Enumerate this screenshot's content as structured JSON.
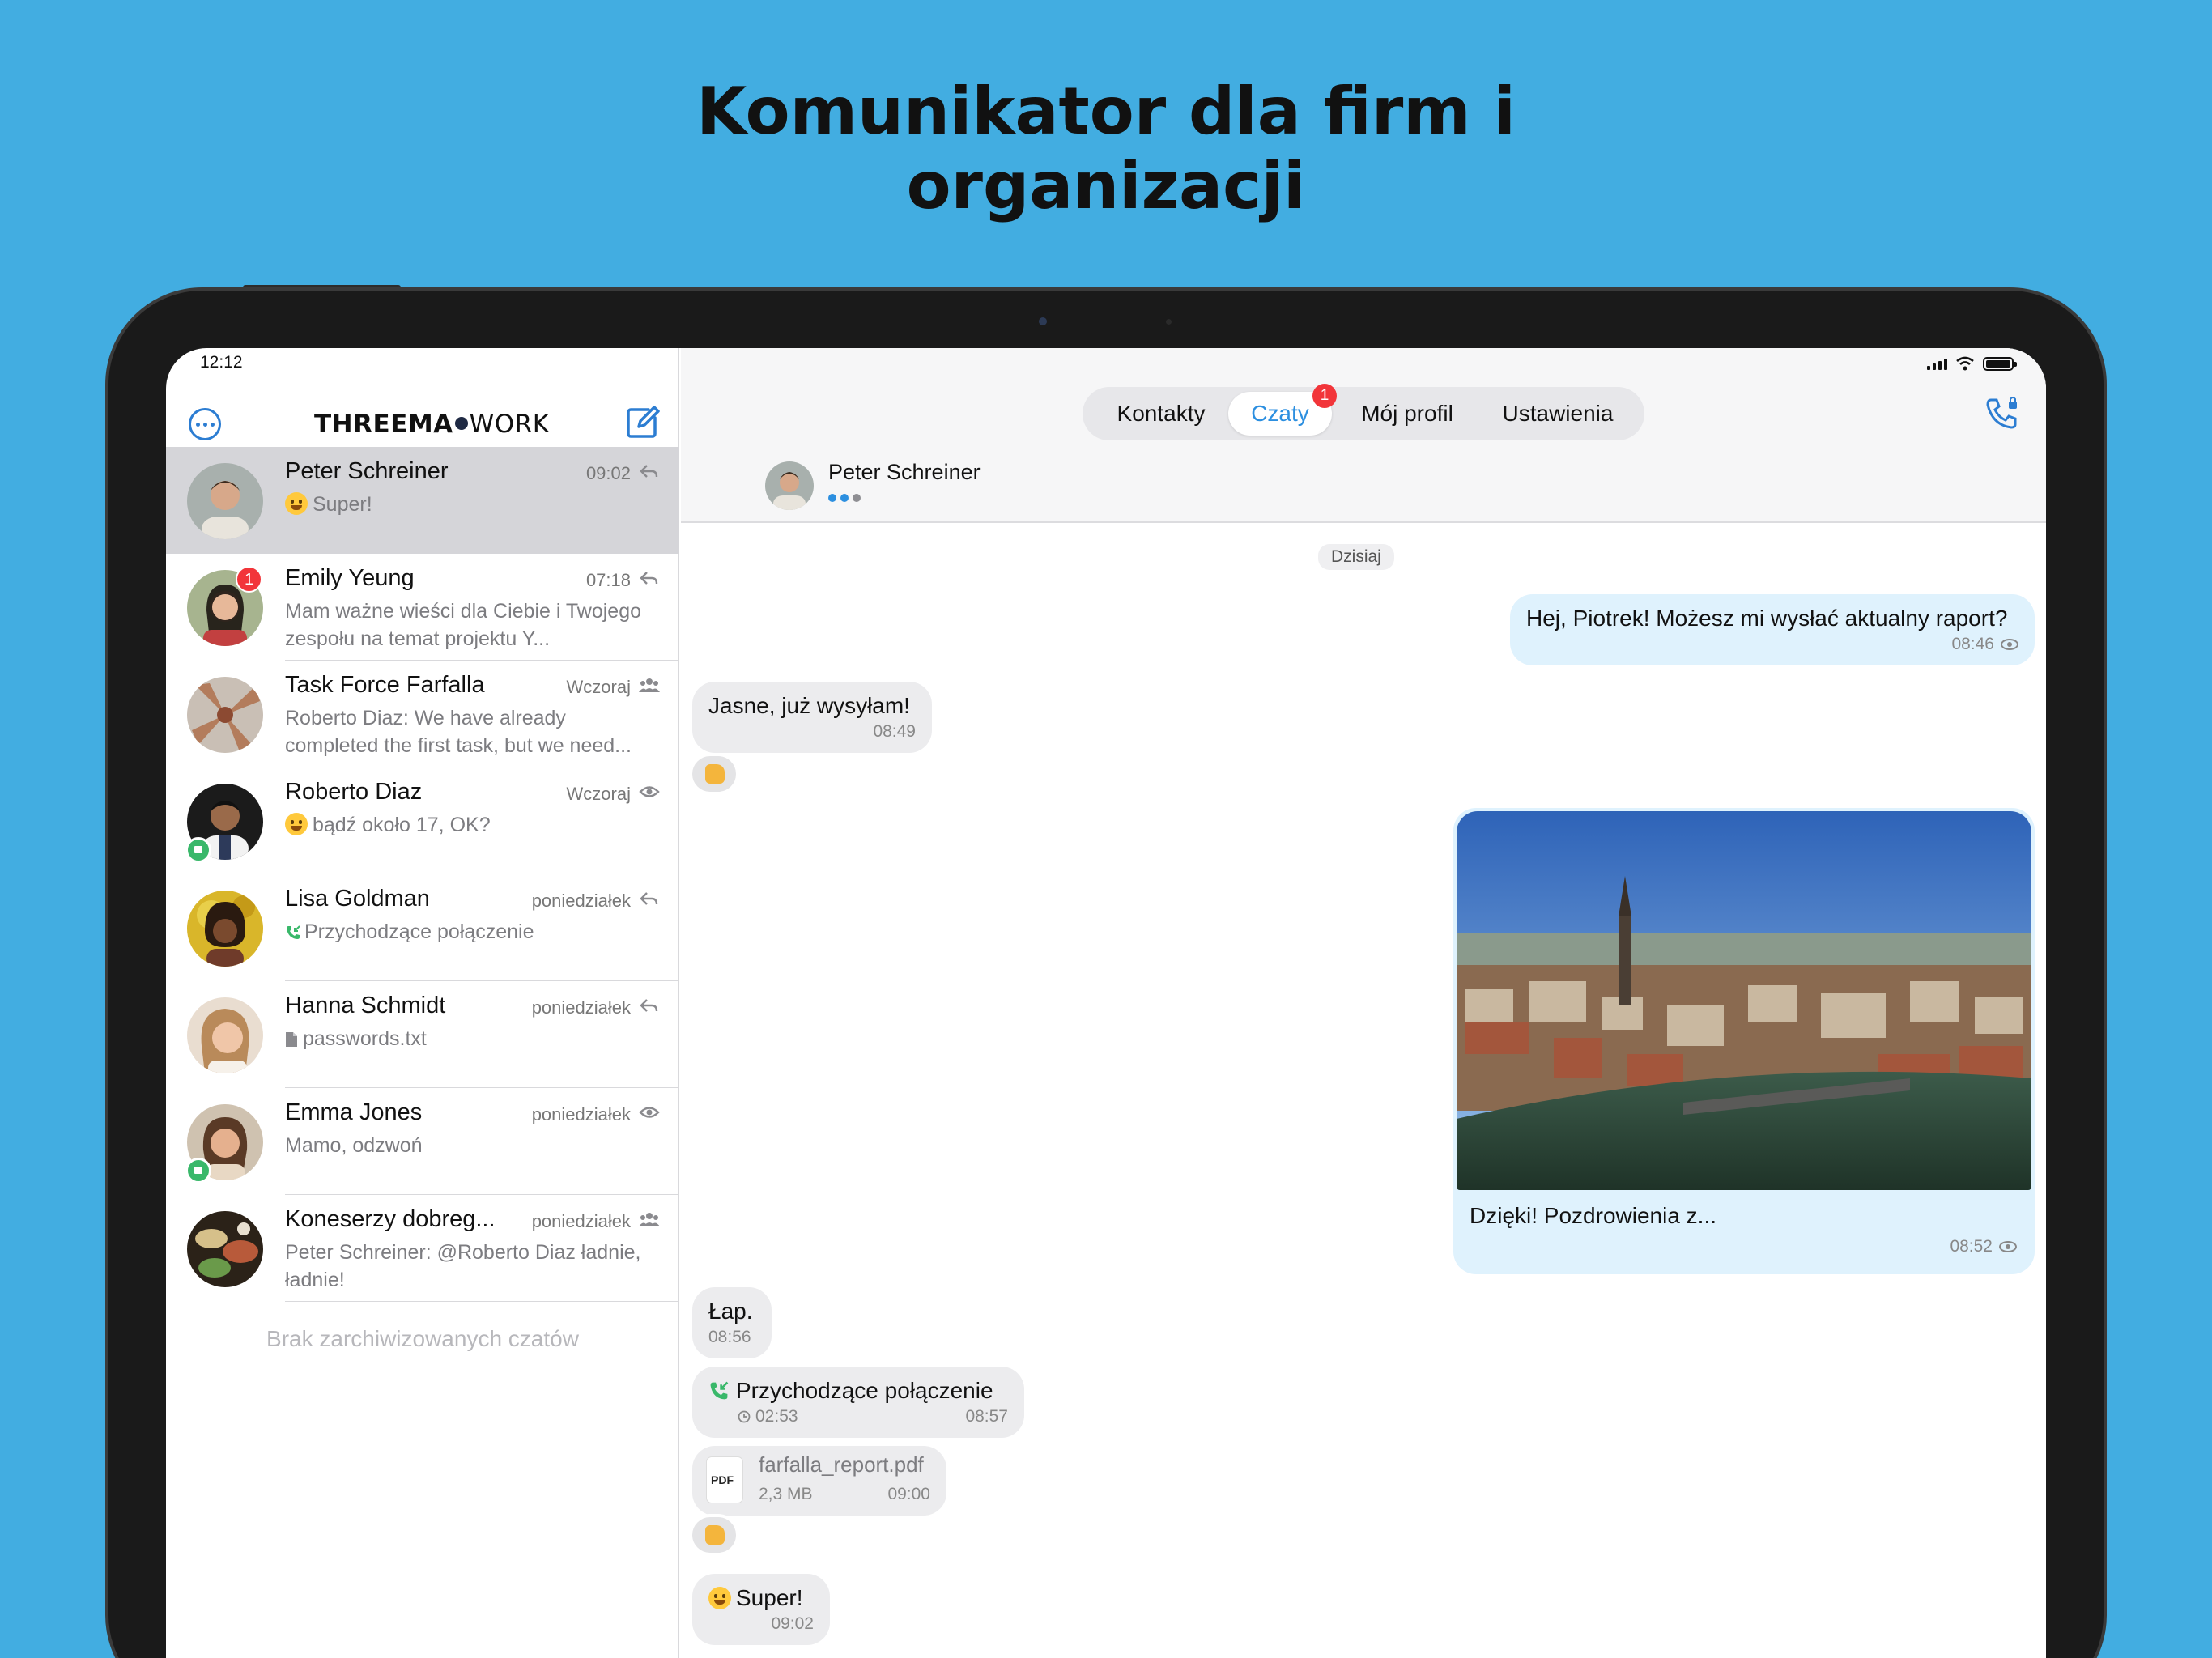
{
  "headline": {
    "line1": "Komunikator dla firm i",
    "line2": "organizacji"
  },
  "status": {
    "time": "12:12"
  },
  "sidebar": {
    "logo_bold": "THREEMA",
    "logo_light": "WORK",
    "chats": [
      {
        "name": "Peter Schreiner",
        "time": "09:02",
        "preview": "Super!",
        "state": "reply",
        "active": true
      },
      {
        "name": "Emily Yeung",
        "time": "07:18",
        "preview": "Mam ważne wieści dla Ciebie i Twojego zespołu na temat projektu Y...",
        "state": "reply",
        "badge": "1"
      },
      {
        "name": "Task Force Farfalla",
        "time": "Wczoraj",
        "preview": "Roberto Diaz: We have already completed the first task, but we need...",
        "state": "group"
      },
      {
        "name": "Roberto Diaz",
        "time": "Wczoraj",
        "preview": "bądź około 17, OK?",
        "state": "seen"
      },
      {
        "name": "Lisa Goldman",
        "time": "poniedziałek",
        "preview": "Przychodzące połączenie",
        "state": "reply"
      },
      {
        "name": "Hanna Schmidt",
        "time": "poniedziałek",
        "preview": "passwords.txt",
        "state": "reply"
      },
      {
        "name": "Emma Jones",
        "time": "poniedziałek",
        "preview": "Mamo, odzwoń",
        "state": "seen"
      },
      {
        "name": "Koneserzy dobreg...",
        "time": "poniedziałek",
        "preview": "Peter Schreiner: @Roberto Diaz ładnie, ładnie!",
        "state": "group"
      }
    ],
    "archive_note": "Brak zarchiwizowanych czatów"
  },
  "tabs": [
    {
      "label": "Kontakty"
    },
    {
      "label": "Czaty",
      "badge": "1"
    },
    {
      "label": "Mój profil"
    },
    {
      "label": "Ustawienia"
    }
  ],
  "conversation": {
    "name": "Peter Schreiner",
    "day": "Dzisiaj",
    "messages": [
      {
        "text": "Hej, Piotrek! Możesz mi wysłać aktualny raport?",
        "time": "08:46"
      },
      {
        "text": "Jasne, już wysyłam!",
        "time": "08:49"
      },
      {
        "caption": "Dzięki! Pozdrowienia z...",
        "time": "08:52"
      },
      {
        "text": "Łap.",
        "time": "08:56"
      },
      {
        "text": "Przychodzące połączenie",
        "duration": "02:53",
        "time": "08:57"
      },
      {
        "file": "farfalla_report.pdf",
        "size": "2,3 MB",
        "time": "09:00",
        "icon_label": "PDF"
      },
      {
        "text": "Super!",
        "time": "09:02"
      }
    ]
  },
  "colors": {
    "background": "#42ade1",
    "accent": "#2c8fe0",
    "badge": "#f2353a",
    "outgoing": "#dff2fd",
    "incoming": "#ececee"
  }
}
